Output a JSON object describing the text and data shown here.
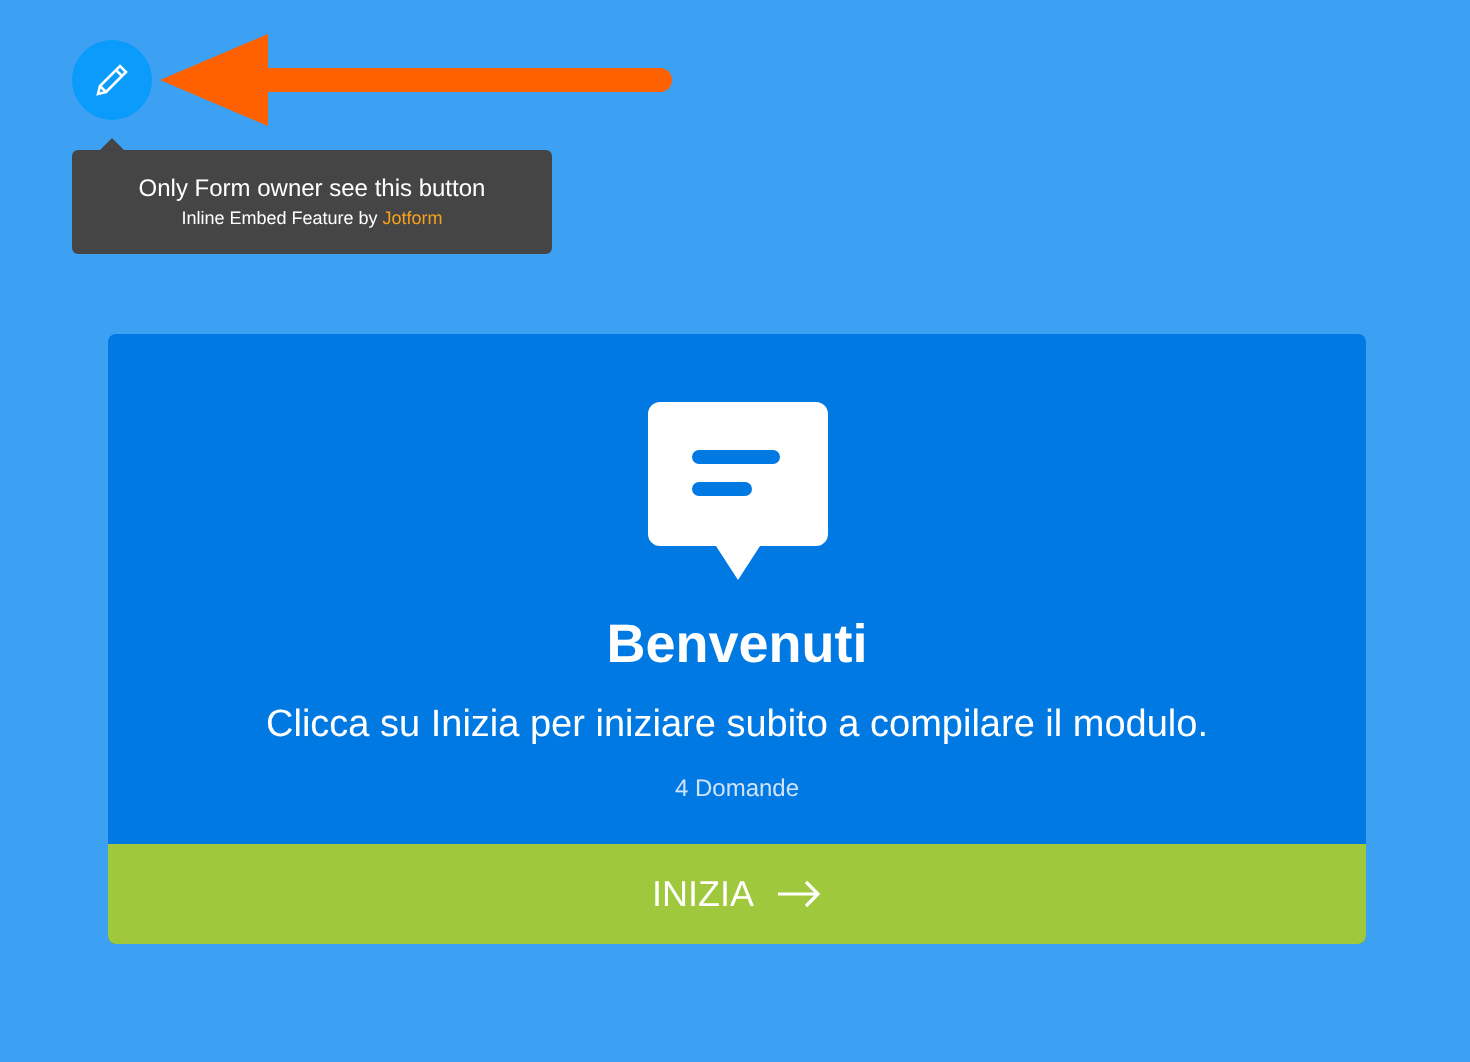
{
  "tooltip": {
    "title": "Only Form owner see this button",
    "credit": "Inline Embed Feature by **Jotform**"
  },
  "card": {
    "title": "Benvenuti",
    "description": "Clicca su Inizia per iniziare subito a compilare il modulo.",
    "question_count": "4 Domande"
  },
  "start_button": {
    "label": "INIZIA"
  }
}
